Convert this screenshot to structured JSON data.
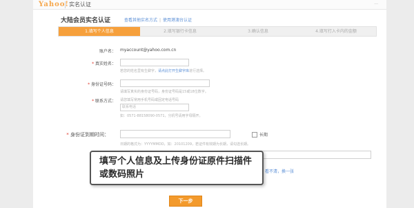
{
  "header": {
    "logo_text": "Yahoo!",
    "title": "实名认证",
    "top_links": "···"
  },
  "page": {
    "title": "大陆会员实名认证",
    "sub_links": [
      "查看其他实名方式",
      "使用港澳台认证"
    ]
  },
  "steps": [
    {
      "label": "1.填写个人信息",
      "active": true
    },
    {
      "label": "2.填写银行卡信息",
      "active": false
    },
    {
      "label": "3.确认信息",
      "active": false
    },
    {
      "label": "4.填写打入卡内的金额",
      "active": false
    }
  ],
  "form": {
    "account_label": "账户名：",
    "account_value": "myaccount@yahoo.com.cn",
    "name_label": "真实姓名：",
    "name_hint": "若您的姓名里有生僻字，",
    "name_hint_link": "请点此打开生僻字库",
    "name_hint_tail": "进行选择。",
    "id_label": "身份证号码：",
    "id_hint": "请填写真实的身份证号码，身份证号码是15或18位数字。",
    "contact_label": "联系方式：",
    "contact_hint": "请您填写常用手机号码或固定电话号码",
    "contact_placeholder": "联系电话",
    "contact_hint2": "如：0571-88158090-0571，分机号请用字母隔开。",
    "id_expiry_label": "身份证到期时间：",
    "id_expiry_hint": "日期的格式为：YYYYMMDD，如：20101209，若证件有效期为长期，请勾选长期。",
    "longterm_label": "长期",
    "agree_link": "看不清，换一张"
  },
  "callout": {
    "text": "填写个人信息及上传身份证原件扫描件或数码照片"
  },
  "buttons": {
    "next_label": "下一步"
  },
  "colors": {
    "accent": "#f39a2c",
    "step_active": "#f6a03c",
    "link": "#5b8fd6",
    "required": "#e03a2e"
  }
}
